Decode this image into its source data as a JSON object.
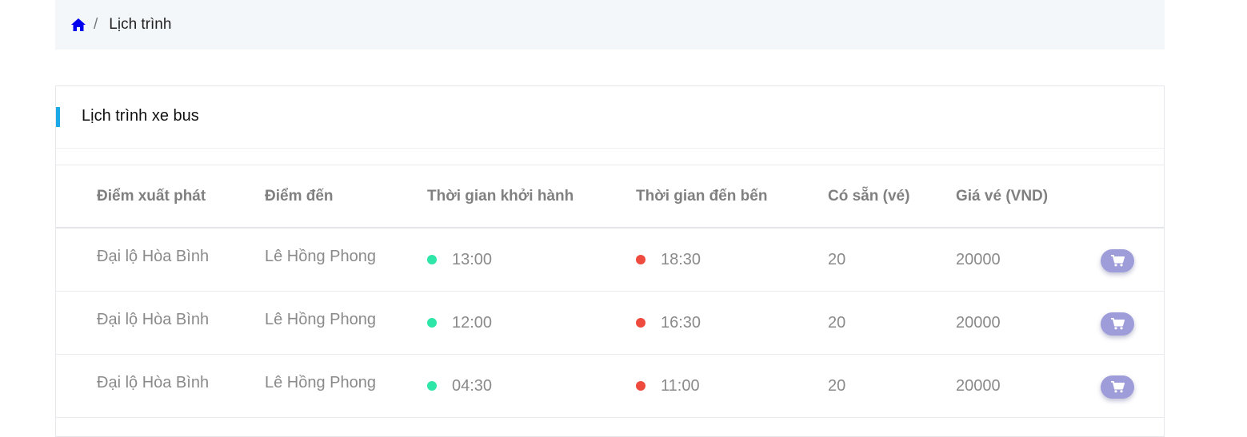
{
  "breadcrumb": {
    "home_icon": "home-icon",
    "separator": "/",
    "current": "Lịch trình"
  },
  "card": {
    "title": "Lịch trình xe bus",
    "accent_color": "#1ba9e7"
  },
  "table": {
    "headers": [
      "Điểm xuất phát",
      "Điểm đến",
      "Thời gian khởi hành",
      "Thời gian đến bến",
      "Có sẵn (vé)",
      "Giá vé (VND)"
    ],
    "rows": [
      {
        "from": "Đại lộ Hòa Bình",
        "to": "Lê Hồng Phong",
        "depart": "13:00",
        "arrive": "18:30",
        "available": "20",
        "price": "20000",
        "action_icon": "cart-icon"
      },
      {
        "from": "Đại lộ Hòa Bình",
        "to": "Lê Hồng Phong",
        "depart": "12:00",
        "arrive": "16:30",
        "available": "20",
        "price": "20000",
        "action_icon": "cart-icon"
      },
      {
        "from": "Đại lộ Hòa Bình",
        "to": "Lê Hồng Phong",
        "depart": "04:30",
        "arrive": "11:00",
        "available": "20",
        "price": "20000",
        "action_icon": "cart-icon"
      }
    ]
  },
  "colors": {
    "depart_dot": "#2ee6a8",
    "arrive_dot": "#ef4a3e",
    "cart_button": "#9e9dd9",
    "home_icon": "#0000ee"
  }
}
